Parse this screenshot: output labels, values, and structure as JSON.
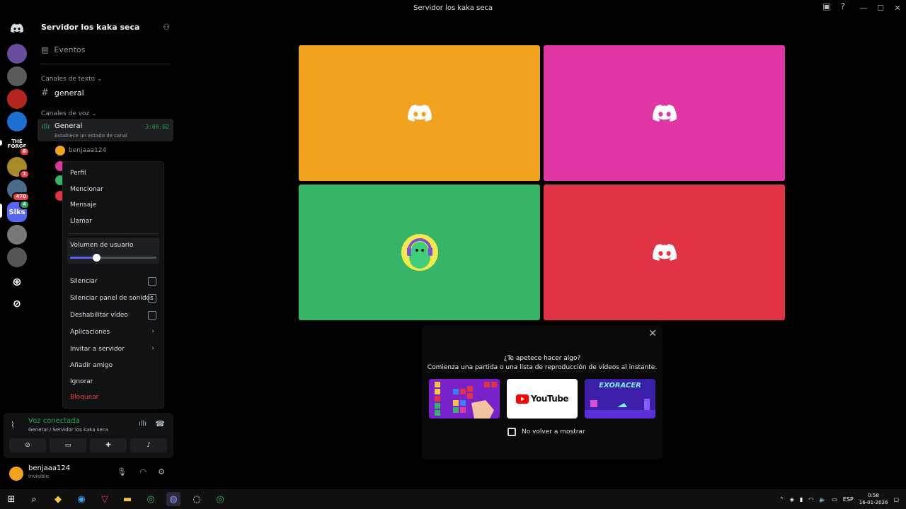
{
  "window": {
    "title": "Servidor los kaka seca",
    "controls": [
      "—",
      "☐",
      "✕"
    ]
  },
  "servers": [
    {
      "label": "",
      "color": "#5865f2",
      "badge": ""
    },
    {
      "label": "",
      "color": "#6a4c9c",
      "badge": ""
    },
    {
      "label": "",
      "color": "#5a5a5a",
      "badge": ""
    },
    {
      "label": "",
      "color": "#b3261e",
      "badge": ""
    },
    {
      "label": "",
      "color": "#1d6fd1",
      "badge": ""
    },
    {
      "label": "THE FORGE",
      "color": "#000000",
      "badge": "6"
    },
    {
      "label": "",
      "color": "#a88a2a",
      "badge": "1"
    },
    {
      "label": "",
      "color": "#4a6b8a",
      "badge": "470"
    },
    {
      "label": "Slks",
      "color": "#5865f2",
      "badge": "4"
    },
    {
      "label": "",
      "color": "#777777",
      "badge": ""
    },
    {
      "label": "",
      "color": "#555555",
      "badge": ""
    }
  ],
  "sidebar": {
    "server_name": "Servidor los kaka seca",
    "events": "Eventos",
    "text_category": "Canales de texto",
    "text_channel": "general",
    "voice_category": "Canales de voz",
    "voice_channel": {
      "name": "General",
      "status": "Establece un estado de canal",
      "timer": "3:06:02"
    },
    "voice_users": [
      {
        "name": "benjaaa124",
        "color": "#f0a31f"
      },
      {
        "name": "",
        "color": "#e037a5"
      },
      {
        "name": "",
        "color": "#36b468"
      },
      {
        "name": "",
        "color": "#e03444"
      }
    ]
  },
  "context_menu": {
    "profile": "Perfil",
    "mention": "Mencionar",
    "message": "Mensaje",
    "call": "Llamar",
    "volume_label": "Volumen de usuario",
    "volume_value": 0.3,
    "mute": "Silenciar",
    "mute_soundboard": "Silenciar panel de sonidos",
    "disable_video": "Deshabilitar vídeo",
    "apps": "Aplicaciones",
    "invite": "Invitar a servidor",
    "add_friend": "Añadir amigo",
    "ignore": "Ignorar",
    "block": "Bloquear"
  },
  "voice_panel": {
    "status": "Voz conectada",
    "location": "General / Servidor los kaka seca"
  },
  "user": {
    "name": "benjaaa124",
    "status": "Invisible"
  },
  "tiles": [
    {
      "color": "#f0a31f",
      "type": "logo"
    },
    {
      "color": "#e037a5",
      "type": "logo"
    },
    {
      "color": "#36b468",
      "type": "avatar"
    },
    {
      "color": "#e03444",
      "type": "logo"
    }
  ],
  "popup": {
    "question": "¿Te apetece hacer algo?",
    "subtitle": "Comienza una partida o una lista de reproducción de vídeos al instante.",
    "youtube": "YouTube",
    "exoracer": "EXORACER",
    "dont_show": "No volver a mostrar"
  },
  "taskbar": {
    "lang": "ESP",
    "time": "0:58",
    "date": "16-01-2026"
  }
}
